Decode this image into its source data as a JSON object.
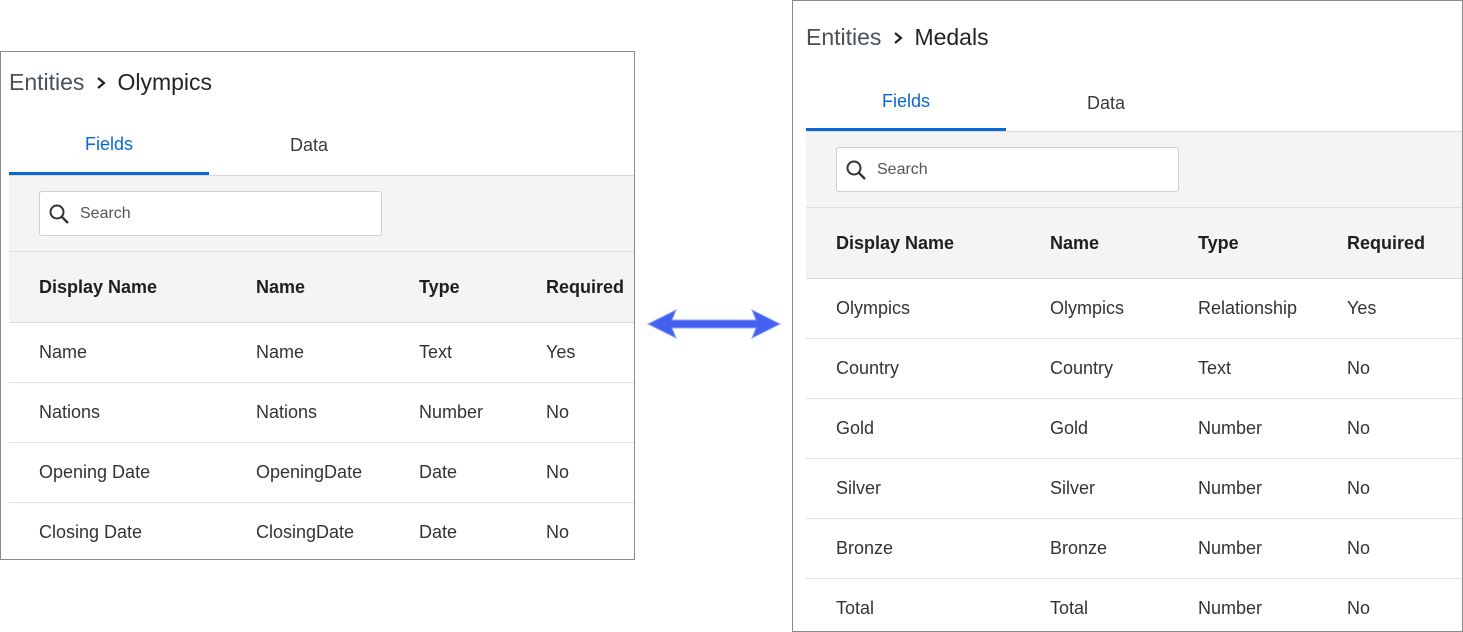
{
  "left_panel": {
    "breadcrumb": {
      "parent": "Entities",
      "current": "Olympics"
    },
    "tabs": [
      "Fields",
      "Data"
    ],
    "active_tab": "Fields",
    "search": {
      "placeholder": "Search"
    },
    "columns": [
      "Display Name",
      "Name",
      "Type",
      "Required"
    ],
    "rows": [
      [
        "Name",
        "Name",
        "Text",
        "Yes"
      ],
      [
        "Nations",
        "Nations",
        "Number",
        "No"
      ],
      [
        "Opening Date",
        "OpeningDate",
        "Date",
        "No"
      ],
      [
        "Closing Date",
        "ClosingDate",
        "Date",
        "No"
      ]
    ]
  },
  "right_panel": {
    "breadcrumb": {
      "parent": "Entities",
      "current": "Medals"
    },
    "tabs": [
      "Fields",
      "Data"
    ],
    "active_tab": "Fields",
    "search": {
      "placeholder": "Search"
    },
    "columns": [
      "Display Name",
      "Name",
      "Type",
      "Required"
    ],
    "rows": [
      [
        "Olympics",
        "Olympics",
        "Relationship",
        "Yes"
      ],
      [
        "Country",
        "Country",
        "Text",
        "No"
      ],
      [
        "Gold",
        "Gold",
        "Number",
        "No"
      ],
      [
        "Silver",
        "Silver",
        "Number",
        "No"
      ],
      [
        "Bronze",
        "Bronze",
        "Number",
        "No"
      ],
      [
        "Total",
        "Total",
        "Number",
        "No"
      ]
    ]
  },
  "connector": {
    "icon": "double-headed-arrow-icon",
    "color": "#4361ee"
  },
  "colors": {
    "accent": "#0b66d6"
  }
}
